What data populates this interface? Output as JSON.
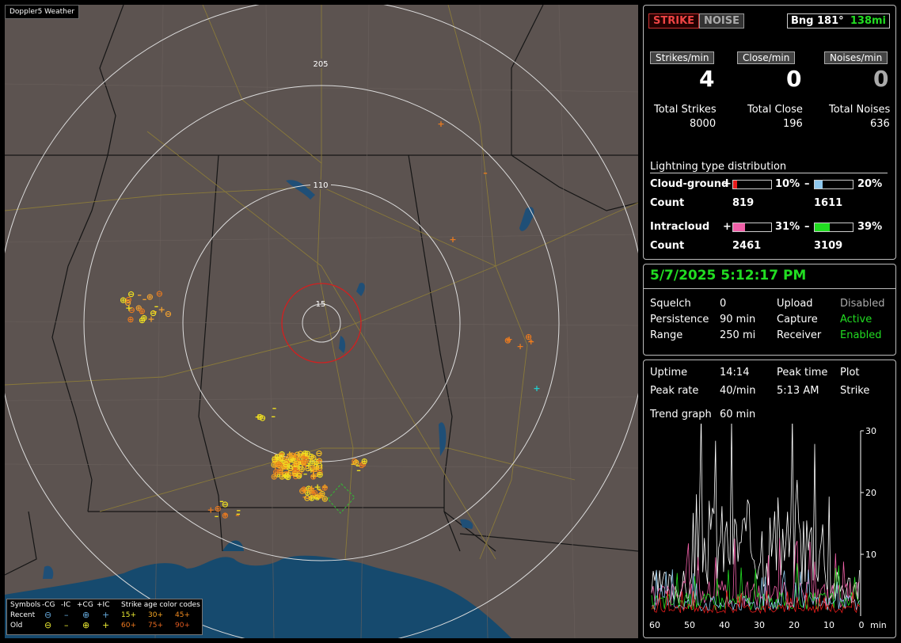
{
  "map": {
    "title": "Doppler5 Weather",
    "range_labels": [
      "205",
      "110",
      "15"
    ]
  },
  "legend": {
    "symbols_label": "Symbols",
    "cols": [
      "-CG",
      "-IC",
      "+CG",
      "+IC"
    ],
    "age_label": "Strike age color codes",
    "recent_label": "Recent",
    "old_label": "Old",
    "recent_ages": [
      "15+",
      "30+",
      "45+"
    ],
    "old_ages": [
      "60+",
      "75+",
      "90+"
    ]
  },
  "stats": {
    "strike_btn": "STRIKE",
    "noise_btn": "NOISE",
    "bearing_label": "Bng 181°",
    "bearing_dist": "138mi",
    "strikes_min_label": "Strikes/min",
    "close_min_label": "Close/min",
    "noises_min_label": "Noises/min",
    "strikes_min": "4",
    "close_min": "0",
    "noises_min": "0",
    "total_strikes_label": "Total Strikes",
    "total_close_label": "Total Close",
    "total_noises_label": "Total Noises",
    "total_strikes": "8000",
    "total_close": "196",
    "total_noises": "636",
    "dist_title": "Lightning type distribution",
    "cg_label": "Cloud-ground",
    "ic_label": "Intracloud",
    "count_label": "Count",
    "plus": "+",
    "minus": "–",
    "cg_pos_pct": "10%",
    "cg_neg_pct": "20%",
    "ic_pos_pct": "31%",
    "ic_neg_pct": "39%",
    "cg_pos_frac": 0.1,
    "cg_neg_frac": 0.2,
    "ic_pos_frac": 0.31,
    "ic_neg_frac": 0.39,
    "cg_pos_count": "819",
    "cg_neg_count": "1611",
    "ic_pos_count": "2461",
    "ic_neg_count": "3109"
  },
  "status": {
    "datetime": "5/7/2025 5:12:17 PM",
    "squelch_label": "Squelch",
    "squelch": "0",
    "persistence_label": "Persistence",
    "persistence": "90 min",
    "range_label": "Range",
    "range": "250 mi",
    "upload_label": "Upload",
    "upload": "Disabled",
    "capture_label": "Capture",
    "capture": "Active",
    "receiver_label": "Receiver",
    "receiver": "Enabled"
  },
  "trend": {
    "uptime_label": "Uptime",
    "uptime": "14:14",
    "peak_time_label": "Peak time",
    "peak_time": "5:13 AM",
    "plot_label": "Plot",
    "plot": "Strike",
    "peak_rate_label": "Peak rate",
    "peak_rate": "40/min",
    "trend_label": "Trend graph",
    "trend_val": "60 min",
    "y_ticks": [
      "30",
      "20",
      "10"
    ],
    "x_ticks": [
      "60",
      "50",
      "40",
      "30",
      "20",
      "10",
      "0"
    ],
    "x_unit": "min"
  },
  "colors": {
    "cg_pos": "#e81c1c",
    "cg_neg": "#8fc8ee",
    "ic_pos": "#f060a8",
    "ic_neg": "#22dd22",
    "active": "#22dd22",
    "bearing": "#22dd22"
  }
}
